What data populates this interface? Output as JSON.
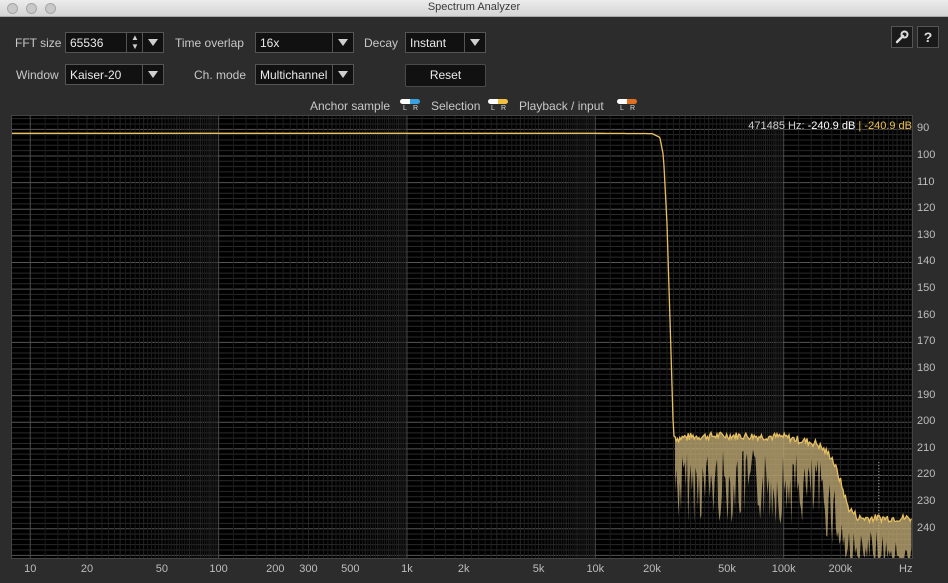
{
  "window": {
    "title": "Spectrum Analyzer"
  },
  "controls": {
    "fft_size_label": "FFT size",
    "fft_size_value": "65536",
    "time_overlap_label": "Time overlap",
    "time_overlap_value": "16x",
    "decay_label": "Decay",
    "decay_value": "Instant",
    "window_label": "Window",
    "window_value": "Kaiser-20",
    "ch_mode_label": "Ch. mode",
    "ch_mode_value": "Multichannel",
    "reset_label": "Reset",
    "help_label": "?"
  },
  "legend": {
    "anchor_label": "Anchor sample",
    "selection_label": "Selection",
    "playback_label": "Playback / input",
    "l": "L",
    "r": "R",
    "colors": {
      "anchor": "#3aa0e0",
      "selection": "#f0c040",
      "playback": "#e07020"
    }
  },
  "readout": {
    "freq": "471485 Hz:",
    "value1": "-240.9 dB",
    "separator": "|",
    "value2": "-240.9 dB"
  },
  "chart_data": {
    "type": "line",
    "xscale": "log",
    "xlim": [
      8,
      480000
    ],
    "ylim": [
      -251,
      -85
    ],
    "y_ticks": [
      -90,
      -100,
      -110,
      -120,
      -130,
      -140,
      -150,
      -160,
      -170,
      -180,
      -190,
      -200,
      -210,
      -220,
      -230,
      -240
    ],
    "x_ticks": [
      "10",
      "20",
      "50",
      "100",
      "200",
      "300",
      "500",
      "1k",
      "2k",
      "5k",
      "10k",
      "20k",
      "50k",
      "100k",
      "200k"
    ],
    "x_unit": "Hz",
    "grid": true,
    "series": [
      {
        "color": "#e8c060",
        "x": [
          8,
          1000,
          10000,
          20000,
          22000,
          23000,
          24000,
          25000,
          26000,
          27000,
          28000,
          30000,
          50000,
          100000,
          150000,
          180000,
          200000,
          220000,
          250000,
          300000,
          400000,
          480000
        ],
        "y": [
          -91.5,
          -91.5,
          -91.5,
          -91.6,
          -93,
          -100,
          -125,
          -165,
          -205,
          -206,
          -206,
          -205.5,
          -205,
          -205.5,
          -208,
          -213,
          -222,
          -232,
          -236,
          -236,
          -236,
          -236
        ]
      }
    ]
  }
}
